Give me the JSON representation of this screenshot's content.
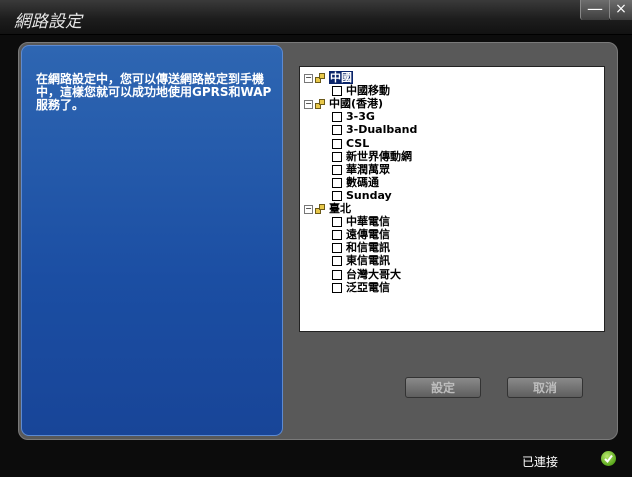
{
  "window": {
    "title": "網路設定",
    "minimize_symbol": "—",
    "close_symbol": "×"
  },
  "description": "在網路設定中，您可以傳送網路設定到手機中，這樣您就可以成功地使用GPRS和WAP服務了。",
  "tree": {
    "groups": [
      {
        "label": "中國",
        "selected": true,
        "items": [
          "中國移動"
        ]
      },
      {
        "label": "中國(香港)",
        "items": [
          "3-3G",
          "3-Dualband",
          "CSL",
          "新世界傳動網",
          "華潤萬眾",
          "數碼通",
          "Sunday"
        ]
      },
      {
        "label": "臺北",
        "items": [
          "中華電信",
          "遠傳電信",
          "和信電訊",
          "東信電訊",
          "台灣大哥大",
          "泛亞電信"
        ]
      }
    ],
    "expander_symbol": "−"
  },
  "buttons": {
    "set": "設定",
    "cancel": "取消"
  },
  "status": {
    "text": "已連接",
    "icon": "check-icon"
  },
  "colors": {
    "accent_blue": "#1f53a6",
    "frame_gray": "#595959",
    "ok_green": "#5aa81d"
  }
}
